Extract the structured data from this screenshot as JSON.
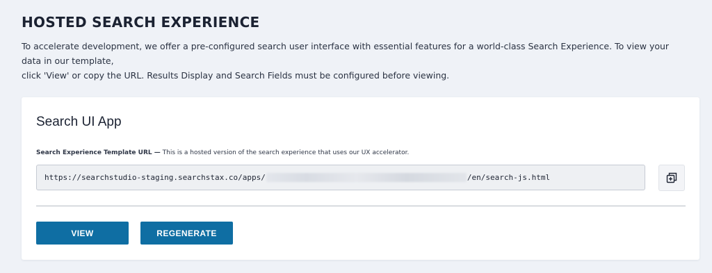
{
  "page": {
    "title": "HOSTED SEARCH EXPERIENCE",
    "intro_lines": [
      "To accelerate development, we offer a pre-configured search user interface with essential features for a world-class Search Experience. To view your data in our template,",
      "click 'View' or copy the URL. Results Display and Search Fields must be configured before viewing."
    ]
  },
  "card": {
    "title": "Search UI App",
    "field_label_bold": "Search Experience Template URL —",
    "field_label_text": " This is a hosted version of the search experience that uses our UX accelerator.",
    "url_prefix": "https://searchstudio-staging.searchstax.co/apps/",
    "url_suffix": "/en/search-js.html",
    "copy_icon": "copy-icon",
    "buttons": {
      "view": "VIEW",
      "regenerate": "REGENERATE"
    }
  },
  "colors": {
    "background": "#eff2f7",
    "button": "#0f6ea3",
    "card": "#ffffff"
  }
}
